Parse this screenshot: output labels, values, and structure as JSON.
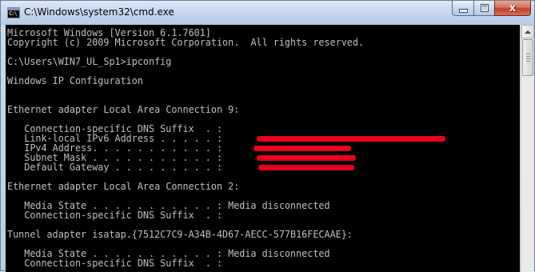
{
  "window": {
    "title": "C:\\Windows\\system32\\cmd.exe",
    "app_icon": "cmd-console-icon",
    "app_icon_text": "C:\\",
    "controls": {
      "minimize_icon": "minimize-icon",
      "maximize_icon": "maximize-icon",
      "close_icon": "close-icon",
      "close_glyph": "x"
    }
  },
  "console": {
    "background_color": "#000000",
    "text_color": "#c0c0c0",
    "lines": [
      "Microsoft Windows [Version 6.1.7601]",
      "Copyright (c) 2009 Microsoft Corporation.  All rights reserved.",
      "",
      "C:\\Users\\WIN7_UL_Sp1>ipconfig",
      "",
      "Windows IP Configuration",
      "",
      "",
      "Ethernet adapter Local Area Connection 9:",
      "",
      "   Connection-specific DNS Suffix  . :",
      "   Link-local IPv6 Address . . . . . :",
      "   IPv4 Address. . . . . . . . . . . :",
      "   Subnet Mask . . . . . . . . . . . :",
      "   Default Gateway . . . . . . . . . :",
      "",
      "Ethernet adapter Local Area Connection 2:",
      "",
      "   Media State . . . . . . . . . . . : Media disconnected",
      "   Connection-specific DNS Suffix  . :",
      "",
      "Tunnel adapter isatap.{7512C7C9-A34B-4D67-AECC-577B16FECAAE}:",
      "",
      "   Media State . . . . . . . . . . . : Media disconnected",
      "   Connection-specific DNS Suffix  . :"
    ],
    "redaction_color": "#e8001a",
    "redactions": [
      {
        "field": "Link-local IPv6 Address"
      },
      {
        "field": "IPv4 Address"
      },
      {
        "field": "Subnet Mask"
      },
      {
        "field": "Default Gateway"
      }
    ]
  },
  "scrollbar": {
    "up_arrow_icon": "scroll-up-arrow-icon",
    "position": 0
  }
}
